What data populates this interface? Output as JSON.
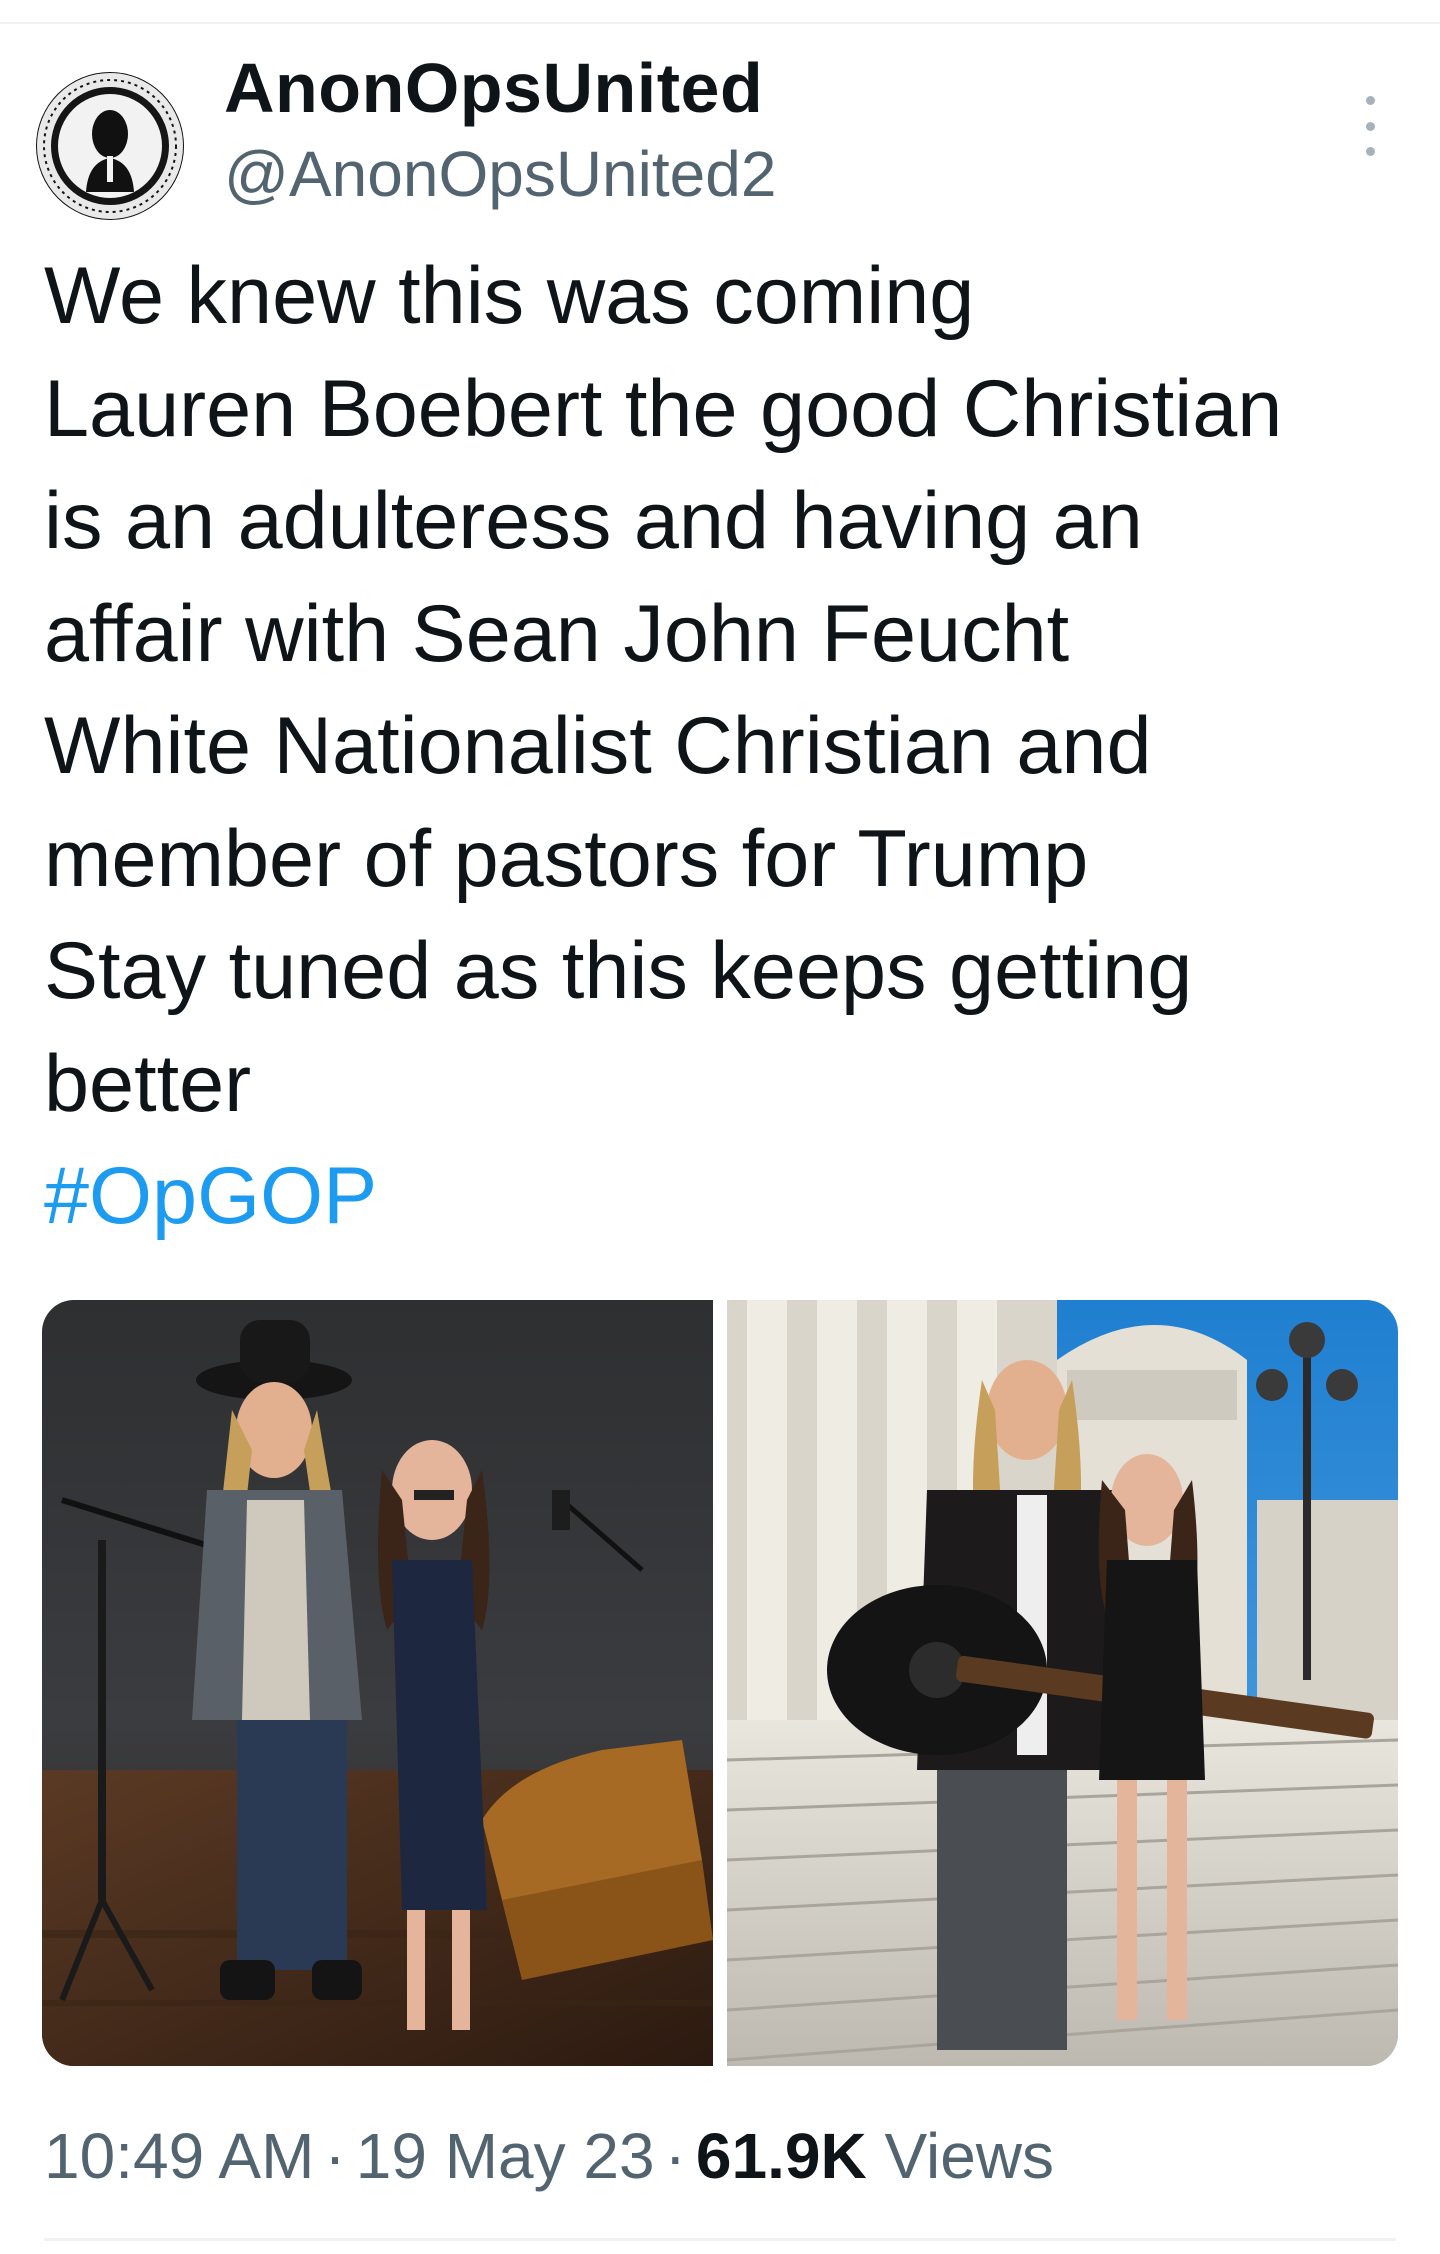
{
  "tweet": {
    "author": {
      "display_name": "AnonOpsUnited",
      "handle": "@AnonOpsUnited2",
      "avatar_icon": "anonymous-mask-icon"
    },
    "text_lines": [
      "We knew this was coming",
      "Lauren Boebert the good Christian",
      "is an adulteress and having an",
      "affair with Sean John Feucht",
      "White Nationalist Christian and",
      "member of pastors for Trump",
      "Stay tuned as this keeps getting",
      "better"
    ],
    "hashtag": "#OpGOP",
    "media": [
      {
        "description_icon": "studio-photo"
      },
      {
        "description_icon": "capitol-steps-photo"
      }
    ],
    "time": "10:49 AM",
    "date": "19 May 23",
    "views_count": "61.9K",
    "views_label": "Views",
    "separator": "·"
  },
  "colors": {
    "link": "#1d9bf0",
    "secondary_text": "#536471",
    "primary_text": "#0f1419"
  }
}
